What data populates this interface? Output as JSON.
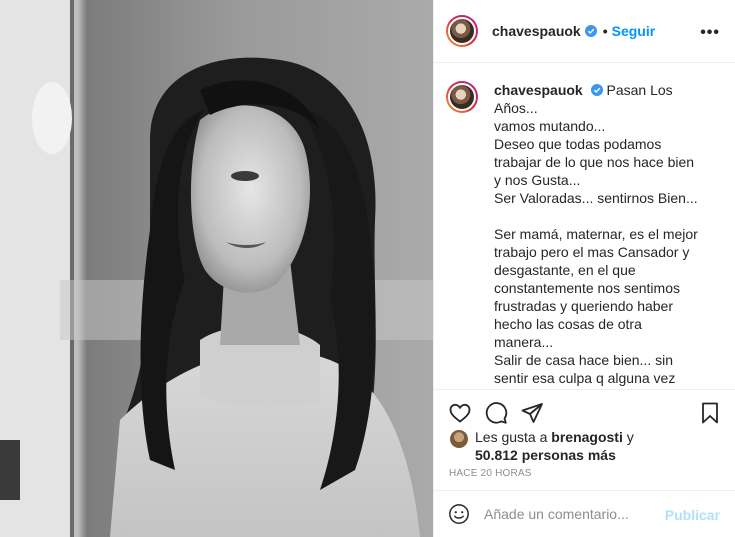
{
  "post": {
    "username": "chavespauok",
    "follow_label": "Seguir",
    "dot": "•",
    "more_label": "•••",
    "caption_user": "chavespauok",
    "caption": "Pasan Los Años...\nvamos mutando...\nDeseo que todas podamos trabajar de lo que nos hace bien y nos Gusta...\nSer Valoradas... sentirnos Bien...\n\nSer mamá, maternar, es el mejor trabajo pero el mas Cansador y desgastante, en el que constantemente nos sentimos frustradas y queriendo haber hecho las cosas de otra manera...\nSalir de casa hace bien... sin sentir esa culpa q alguna vez senti x irme...\nNuestros hijos necesitan Calidad de Tiempo... no Cantidad... y es ahi donde a veces me encuentro",
    "likes_prefix": "Les gusta a ",
    "likes_user": "brenagosti",
    "likes_join": " y",
    "likes_count": "50.812 personas más",
    "time": "HACE 20 HORAS",
    "comment_placeholder": "Añade un comentario...",
    "publish_label": "Publicar"
  },
  "colors": {
    "accent": "#0095f6",
    "publish_disabled": "#b2dffc",
    "muted": "#8e8e8e",
    "text": "#262626"
  },
  "icons": [
    "verified-badge-icon",
    "heart-icon",
    "comment-icon",
    "share-icon",
    "bookmark-icon",
    "emoji-icon"
  ]
}
